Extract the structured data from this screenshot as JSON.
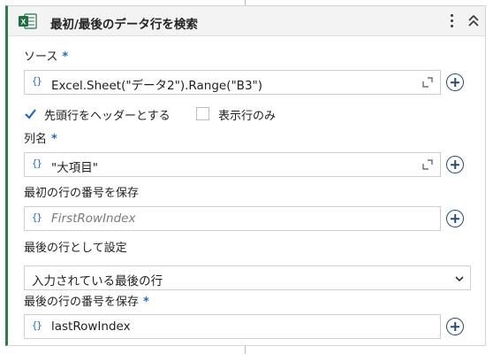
{
  "activity": {
    "title": "最初/最後のデータ行を検索"
  },
  "source": {
    "label": "ソース",
    "required_mark": "*",
    "brace": "{}",
    "value": "Excel.Sheet(\"データ2\").Range(\"B3\")"
  },
  "options": {
    "header_checkbox_label": "先頭行をヘッダーとする",
    "header_checked": true,
    "hidden_checkbox_label": "表示行のみ",
    "hidden_checked": false
  },
  "column": {
    "label": "列名",
    "required_mark": "*",
    "brace": "{}",
    "value": "\"大項目\""
  },
  "first_row": {
    "label": "最初の行の番号を保存",
    "brace": "{}",
    "placeholder": "FirstRowIndex"
  },
  "last_row_setting": {
    "label": "最後の行として設定",
    "selected": "入力されている最後の行"
  },
  "last_row": {
    "label": "最後の行の番号を保存",
    "required_mark": "*",
    "brace": "{}",
    "value": "lastRowIndex"
  },
  "colors": {
    "accent": "#1b6ac9",
    "excel_green": "#1d6f42",
    "card_border_left": "#2e7d4f"
  }
}
